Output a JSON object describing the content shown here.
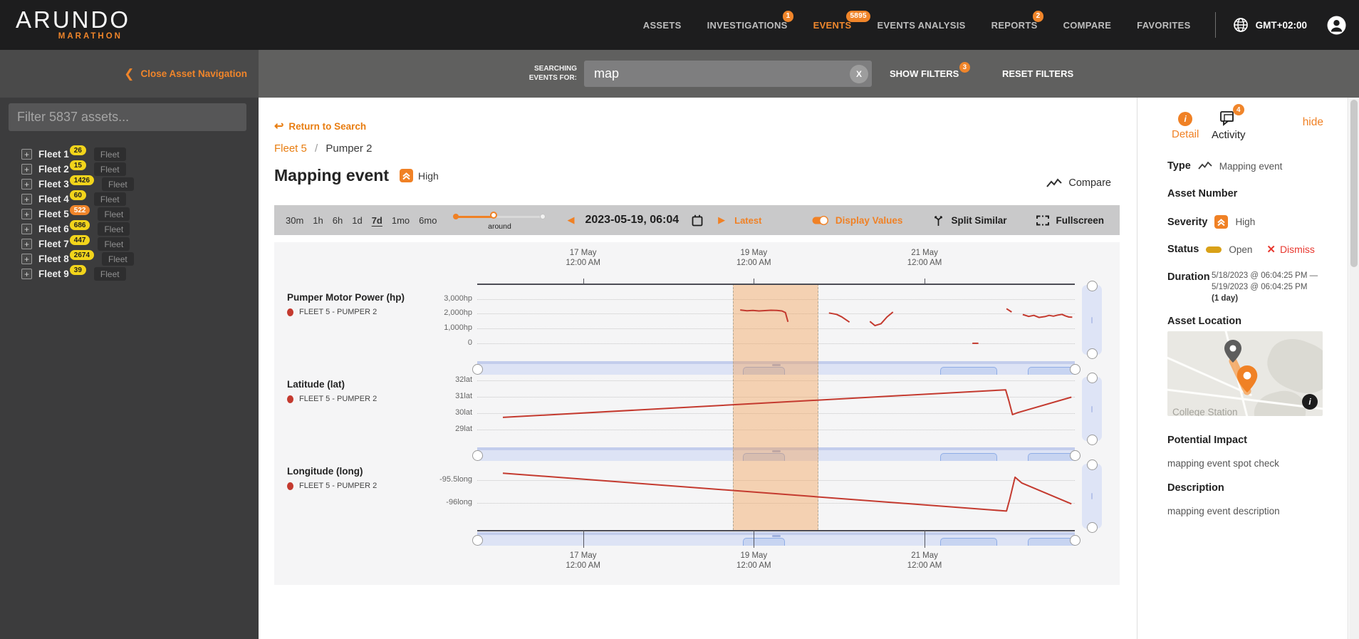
{
  "topbar": {
    "logo_title": "ARUNDO",
    "logo_subtitle": "MARATHON",
    "nav": [
      {
        "label": "ASSETS"
      },
      {
        "label": "INVESTIGATIONS",
        "badge": "1"
      },
      {
        "label": "EVENTS",
        "badge": "5895",
        "active": true
      },
      {
        "label": "EVENTS ANALYSIS"
      },
      {
        "label": "REPORTS",
        "badge": "2"
      },
      {
        "label": "COMPARE"
      },
      {
        "label": "FAVORITES"
      }
    ],
    "timezone": "GMT+02:00"
  },
  "subbar": {
    "close_nav": "Close Asset Navigation",
    "searching_line1": "SEARCHING",
    "searching_line2": "EVENTS FOR:",
    "search_value": "map",
    "clear_label": "X",
    "show_filters": "SHOW FILTERS",
    "show_filters_badge": "3",
    "reset_filters": "RESET FILTERS"
  },
  "sidebar": {
    "filter_placeholder": "Filter 5837 assets...",
    "fleets": [
      {
        "name": "Fleet 1",
        "count": "26",
        "severity": "normal",
        "tag": "Fleet"
      },
      {
        "name": "Fleet 2",
        "count": "15",
        "severity": "normal",
        "tag": "Fleet"
      },
      {
        "name": "Fleet 3",
        "count": "1426",
        "severity": "normal",
        "tag": "Fleet"
      },
      {
        "name": "Fleet 4",
        "count": "60",
        "severity": "normal",
        "tag": "Fleet"
      },
      {
        "name": "Fleet 5",
        "count": "522",
        "severity": "high",
        "tag": "Fleet"
      },
      {
        "name": "Fleet 6",
        "count": "686",
        "severity": "normal",
        "tag": "Fleet"
      },
      {
        "name": "Fleet 7",
        "count": "447",
        "severity": "normal",
        "tag": "Fleet"
      },
      {
        "name": "Fleet 8",
        "count": "2674",
        "severity": "normal",
        "tag": "Fleet"
      },
      {
        "name": "Fleet 9",
        "count": "39",
        "severity": "normal",
        "tag": "Fleet"
      }
    ]
  },
  "main": {
    "return_link": "Return to Search",
    "breadcrumb": {
      "parent": "Fleet 5",
      "separator": "/",
      "current": "Pumper 2"
    },
    "title": "Mapping event",
    "severity": "High",
    "compare": "Compare",
    "toolbar": {
      "ranges": [
        "30m",
        "1h",
        "6h",
        "1d",
        "7d",
        "1mo",
        "6mo"
      ],
      "active_range": "7d",
      "slider_label": "around",
      "date": "2023-05-19, 06:04",
      "latest": "Latest",
      "display_values": "Display Values",
      "split_similar": "Split Similar",
      "fullscreen": "Fullscreen"
    }
  },
  "chart_data": {
    "type": "line",
    "x_axis": {
      "unit": "day-of-May-2023",
      "domain": [
        15.76,
        22.76
      ],
      "ticks": [
        {
          "day": 17,
          "label_line1": "17 May",
          "label_line2": "12:00 AM"
        },
        {
          "day": 19,
          "label_line1": "19 May",
          "label_line2": "12:00 AM"
        },
        {
          "day": 21,
          "label_line1": "21 May",
          "label_line2": "12:00 AM"
        }
      ]
    },
    "event_window": {
      "start_day": 18.755,
      "end_day": 19.755
    },
    "panels": [
      {
        "title": "Pumper Motor Power (hp)",
        "series_label": "FLEET 5 - PUMPER 2",
        "color": "#c43a2f",
        "ylim": [
          -900,
          4070
        ],
        "yticks": [
          {
            "value": 3000,
            "label": "3,000hp"
          },
          {
            "value": 2000,
            "label": "2,000hp"
          },
          {
            "value": 1000,
            "label": "1,000hp"
          },
          {
            "value": 0,
            "label": "0"
          }
        ],
        "segments": [
          [
            [
              18.84,
              2260
            ],
            [
              18.92,
              2205
            ],
            [
              18.99,
              2235
            ],
            [
              19.06,
              2195
            ],
            [
              19.13,
              2220
            ],
            [
              19.2,
              2245
            ],
            [
              19.27,
              2230
            ],
            [
              19.33,
              2195
            ],
            [
              19.37,
              2080
            ],
            [
              19.4,
              1450
            ]
          ],
          [
            [
              19.88,
              2060
            ],
            [
              19.97,
              1960
            ],
            [
              20.03,
              1790
            ],
            [
              20.12,
              1430
            ]
          ],
          [
            [
              20.36,
              1480
            ],
            [
              20.42,
              1190
            ],
            [
              20.49,
              1320
            ],
            [
              20.56,
              1780
            ],
            [
              20.63,
              2120
            ]
          ],
          [
            [
              21.56,
              -20
            ],
            [
              21.63,
              -20
            ]
          ],
          [
            [
              21.96,
              2350
            ],
            [
              22.02,
              2120
            ]
          ],
          [
            [
              22.15,
              1950
            ],
            [
              22.22,
              1820
            ],
            [
              22.28,
              1890
            ],
            [
              22.34,
              1750
            ],
            [
              22.41,
              1810
            ],
            [
              22.46,
              1890
            ],
            [
              22.51,
              1840
            ],
            [
              22.56,
              1910
            ],
            [
              22.61,
              1960
            ],
            [
              22.65,
              1860
            ],
            [
              22.69,
              1780
            ],
            [
              22.73,
              1770
            ]
          ]
        ]
      },
      {
        "title": "Latitude (lat)",
        "series_label": "FLEET 5 - PUMPER 2",
        "color": "#c43a2f",
        "ylim": [
          28.2,
          32.3
        ],
        "yticks": [
          {
            "value": 32,
            "label": "32lat"
          },
          {
            "value": 31,
            "label": "31lat"
          },
          {
            "value": 30,
            "label": "30lat"
          },
          {
            "value": 29,
            "label": "29lat"
          }
        ],
        "segments": [
          [
            [
              16.06,
              29.73
            ],
            [
              21.95,
              31.42
            ],
            [
              21.99,
              30.7
            ],
            [
              22.03,
              29.9
            ],
            [
              22.09,
              30.02
            ],
            [
              22.72,
              30.97
            ]
          ]
        ]
      },
      {
        "title": "Longitude (long)",
        "series_label": "FLEET 5 - PUMPER 2",
        "color": "#c43a2f",
        "ylim": [
          -96.6,
          -95.1
        ],
        "yticks": [
          {
            "value": -95.5,
            "label": "-95.5long"
          },
          {
            "value": -96,
            "label": "-96long"
          }
        ],
        "segments": [
          [
            [
              16.06,
              -95.34
            ],
            [
              21.96,
              -96.18
            ],
            [
              22.0,
              -95.9
            ],
            [
              22.06,
              -95.43
            ],
            [
              22.14,
              -95.56
            ],
            [
              22.72,
              -96.02
            ]
          ]
        ]
      }
    ]
  },
  "detail_panel": {
    "tabs": {
      "detail": "Detail",
      "activity": "Activity",
      "activity_badge": "4",
      "hide": "hide"
    },
    "fields": {
      "type_label": "Type",
      "type_value": "Mapping event",
      "asset_number_label": "Asset Number",
      "severity_label": "Severity",
      "severity_value": "High",
      "status_label": "Status",
      "status_value": "Open",
      "dismiss": "Dismiss",
      "duration_label": "Duration",
      "duration_line1": "5/18/2023 @ 06:04:25 PM —",
      "duration_line2": "5/19/2023 @ 06:04:25 PM",
      "duration_line3": "(1 day)",
      "location_label": "Asset Location",
      "map_place": "College Station",
      "impact_label": "Potential Impact",
      "impact_value": "mapping event spot check",
      "description_label": "Description",
      "description_value": "mapping event description"
    }
  },
  "colors": {
    "accent": "#f08125",
    "badge_yellow": "#f2d41b",
    "badge_orange": "#f0852a",
    "series_red": "#c43a2f",
    "status_open": "#d9a118",
    "dismiss_red": "#e8382f"
  }
}
